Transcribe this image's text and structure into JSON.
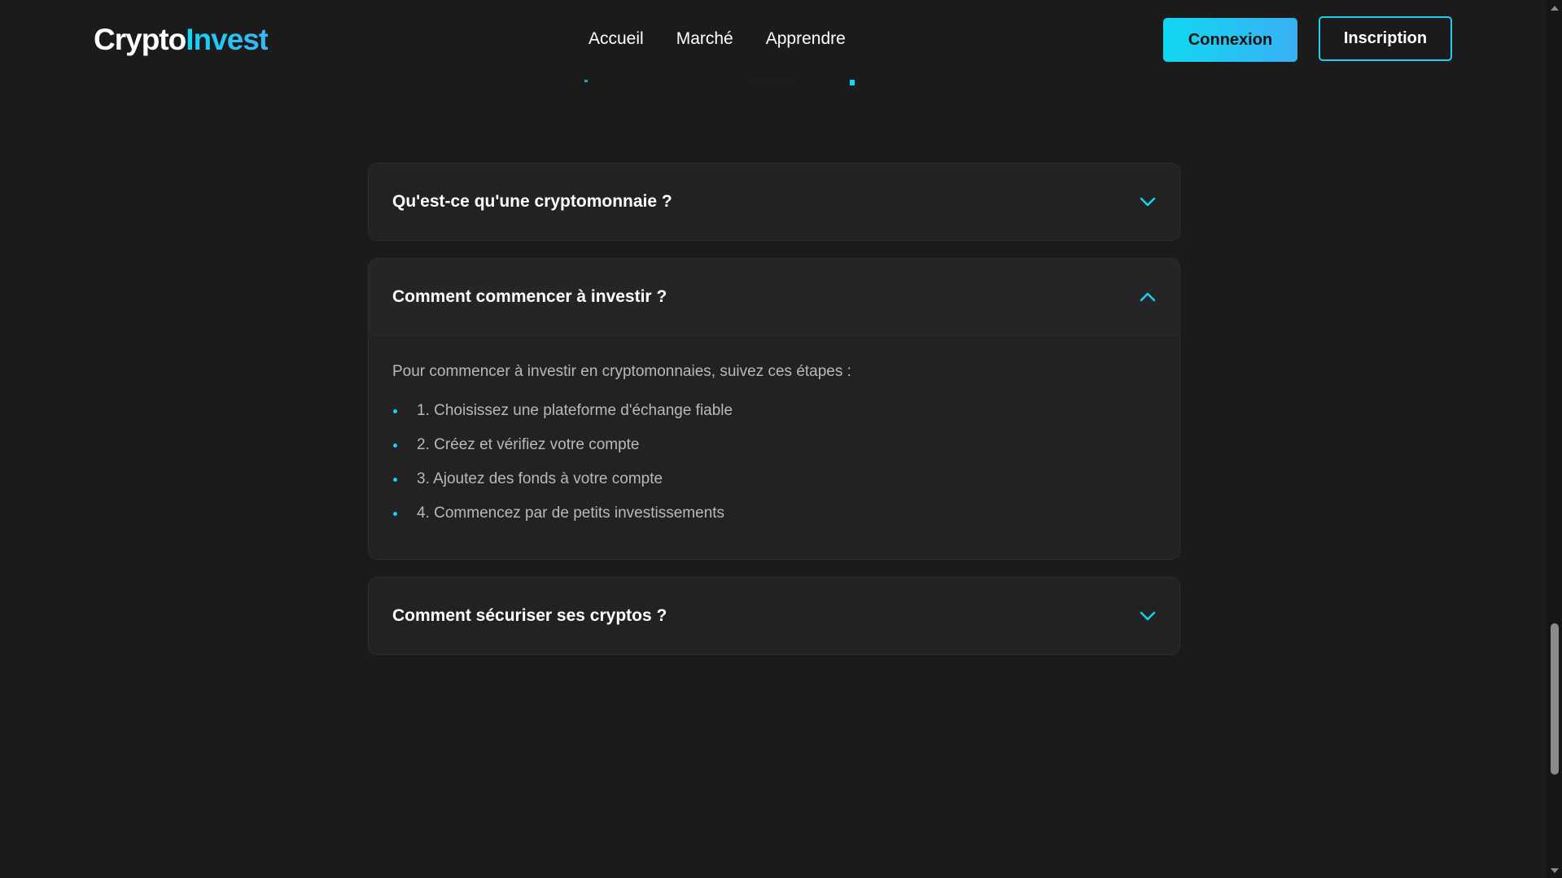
{
  "header": {
    "logo_part1": "Crypto",
    "logo_part2": "Invest",
    "nav": [
      "Accueil",
      "Marché",
      "Apprendre"
    ],
    "login_label": "Connexion",
    "signup_label": "Inscription"
  },
  "faq": {
    "items": [
      {
        "question": "Qu'est-ce qu'une cryptomonnaie ?",
        "open": false
      },
      {
        "question": "Comment commencer à investir ?",
        "open": true,
        "answer_intro": "Pour commencer à investir en cryptomonnaies, suivez ces étapes :",
        "steps": [
          "1. Choisissez une plateforme d'échange fiable",
          "2. Créez et vérifiez votre compte",
          "3. Ajoutez des fonds à votre compte",
          "4. Commencez par de petits investissements"
        ]
      },
      {
        "question": "Comment sécuriser ses cryptos ?",
        "open": false
      }
    ]
  },
  "colors": {
    "accent": "#18d0ee",
    "background": "#1b1b1b",
    "card": "#222222"
  },
  "icons": {
    "collapsed": "chevron-down-icon",
    "expanded": "chevron-up-icon",
    "bullet": "dot-icon"
  }
}
